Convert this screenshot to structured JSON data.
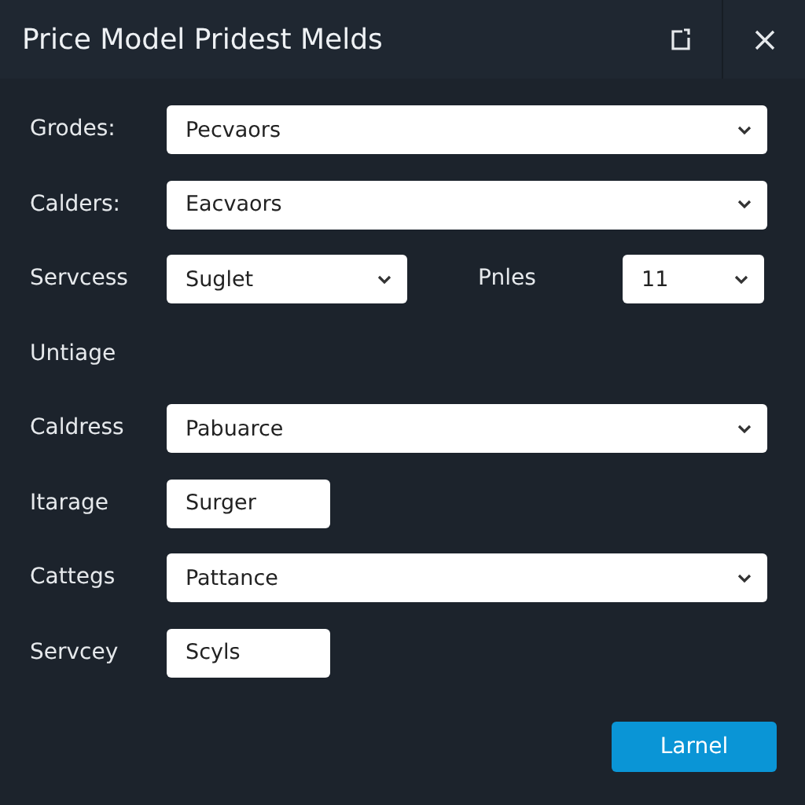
{
  "window": {
    "title": "Price Model Pridest Melds"
  },
  "rows": [
    {
      "kind": "select",
      "label": "Grodes:",
      "value": "Pecvaors"
    },
    {
      "kind": "select",
      "label": "Calders:",
      "value": "Eacvaors"
    },
    {
      "kind": "pair",
      "label": "Servcess",
      "value": "Suglet",
      "label_2": "Pnles",
      "value_2": "11"
    },
    {
      "kind": "heading",
      "label": "Untiage"
    },
    {
      "kind": "select",
      "label": "Caldress",
      "value": "Pabuarce"
    },
    {
      "kind": "input",
      "label": "Itarage",
      "value": "Surger"
    },
    {
      "kind": "select",
      "label": "Cattegs",
      "value": "Pattance"
    },
    {
      "kind": "input",
      "label": "Servcey",
      "value": "Scyls"
    }
  ],
  "buttons": [
    {
      "label": "Larnel"
    }
  ]
}
